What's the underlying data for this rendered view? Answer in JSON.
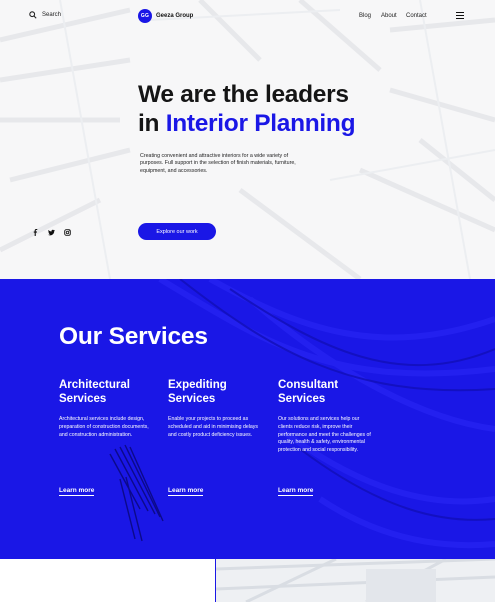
{
  "header": {
    "search_label": "Search",
    "logo_mark": "GG",
    "logo_text": "Geeza Group",
    "nav": [
      {
        "label": "Blog"
      },
      {
        "label": "About"
      },
      {
        "label": "Contact"
      }
    ],
    "menu_icon": "hamburger-icon"
  },
  "hero": {
    "headline_line1": "We are the leaders",
    "headline_prefix": "in ",
    "headline_accent": "Interior Planning",
    "intro": "Creating convenient and attractive interiors for a wide variety of purposes. Full support in the selection of finish materials, furniture, equipment, and accessories.",
    "cta_label": "Explore our work",
    "social_icons": [
      "facebook-icon",
      "twitter-icon",
      "instagram-icon"
    ]
  },
  "services": {
    "title": "Our Services",
    "items": [
      {
        "title": "Architectural Services",
        "description": "Architectural services include design, preparation of construction documents, and construction administration.",
        "link": "Learn more"
      },
      {
        "title": "Expediting Services",
        "description": "Enable your projects to proceed as scheduled and aid in minimising delays and costly product deficiency issues.",
        "link": "Learn more"
      },
      {
        "title": "Consultant Services",
        "description": "Our solutions and services help our clients reduce risk, improve their performance and meet the challenges of quality, health & safety, environmental protection and social responsibility.",
        "link": "Learn more"
      }
    ]
  },
  "colors": {
    "accent": "#1a17e6",
    "text": "#151515",
    "background": "#ffffff"
  }
}
